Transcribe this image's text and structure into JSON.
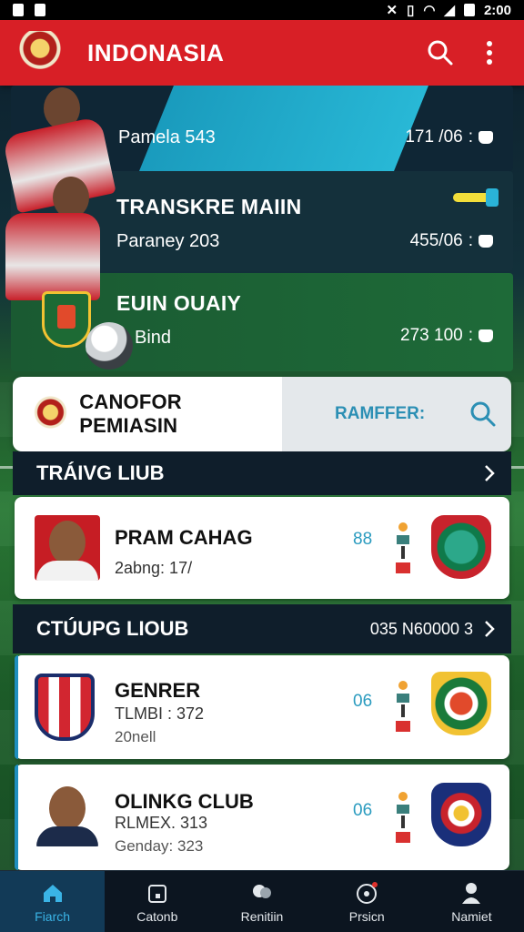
{
  "status_bar": {
    "time": "2:00"
  },
  "app_bar": {
    "title": "INDONASIA"
  },
  "news": [
    {
      "title": "",
      "meta": "Pamela 543",
      "right": "171 /06"
    },
    {
      "title": "TRANSKRE MAIIN",
      "meta": "Paraney 203",
      "right": "455/06"
    },
    {
      "title": "EUIN OUAIY",
      "meta": "Bind",
      "right": "273 100"
    }
  ],
  "search": {
    "left_label": "CANOFOR PEMIASIN",
    "right_label": "RAMFFER:"
  },
  "section1": {
    "title": "TRÁIVG LIUB"
  },
  "section2": {
    "title": "CTÚUPG LIOUB",
    "right": "035 N60000 3"
  },
  "cards": [
    {
      "name": "PRAM CAHAG",
      "sub": "2abng: 17/",
      "sub2": "",
      "num": "88"
    },
    {
      "name": "GENRER",
      "sub": "TLMBI : 372",
      "sub2": "20nell",
      "num": "06"
    },
    {
      "name": "OLINKG CLUB",
      "sub": "RLMEX. 313",
      "sub2": "Genday: 323",
      "num": "06"
    }
  ],
  "bottom_nav": [
    {
      "label": "Fiarch",
      "icon": "home-icon",
      "active": true
    },
    {
      "label": "Catonb",
      "icon": "calendar-icon",
      "active": false
    },
    {
      "label": "Renitiin",
      "icon": "players-icon",
      "active": false
    },
    {
      "label": "Prsicn",
      "icon": "ball-icon",
      "active": false
    },
    {
      "label": "Namiet",
      "icon": "profile-icon",
      "active": false
    }
  ],
  "colors": {
    "primary": "#d81f26",
    "accent": "#2ab3d8",
    "active_nav": "#3ab4e6"
  }
}
